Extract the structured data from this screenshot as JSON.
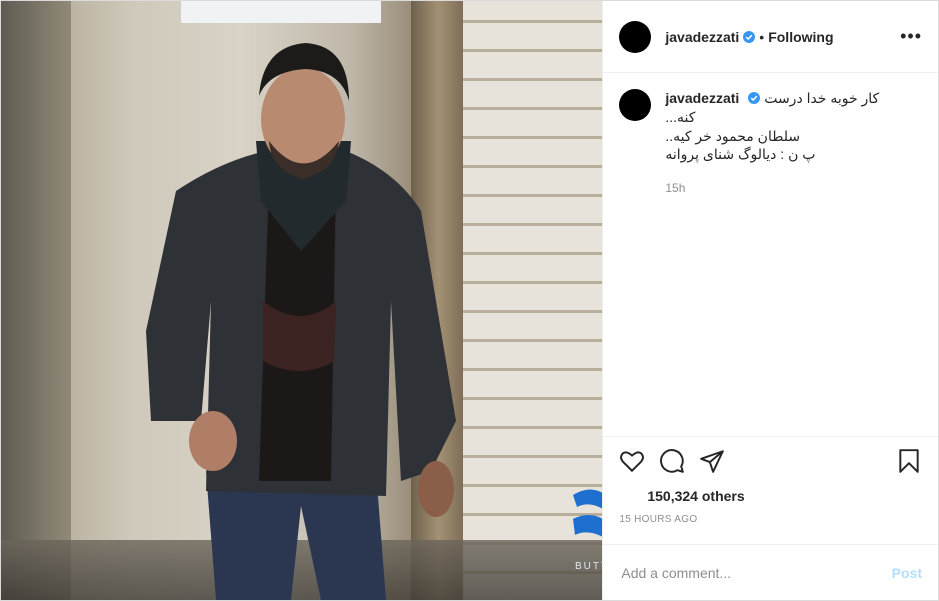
{
  "post": {
    "photo_alt": "",
    "watermark": "BUTT"
  },
  "header": {
    "username": "javadezzati",
    "separator": "•",
    "follow_state": "Following",
    "more": "•••"
  },
  "caption": {
    "username": "javadezzati",
    "lines": [
      "کار خوبه خدا درست کنه...",
      "سلطان محمود خر کیه..",
      "پ ن : دیالوگ شنای پروانه"
    ],
    "time": "15h"
  },
  "actions": {
    "like_icon": "heart-icon",
    "comment_icon": "comment-icon",
    "share_icon": "share-icon",
    "save_icon": "bookmark-icon"
  },
  "likes": "150,324 others",
  "date": "15 HOURS AGO",
  "comment_box": {
    "placeholder": "Add a comment...",
    "post_label": "Post"
  },
  "colors": {
    "verified": "#3897f0",
    "post_disabled": "#b2dffc",
    "muted": "#8e8e8e"
  }
}
